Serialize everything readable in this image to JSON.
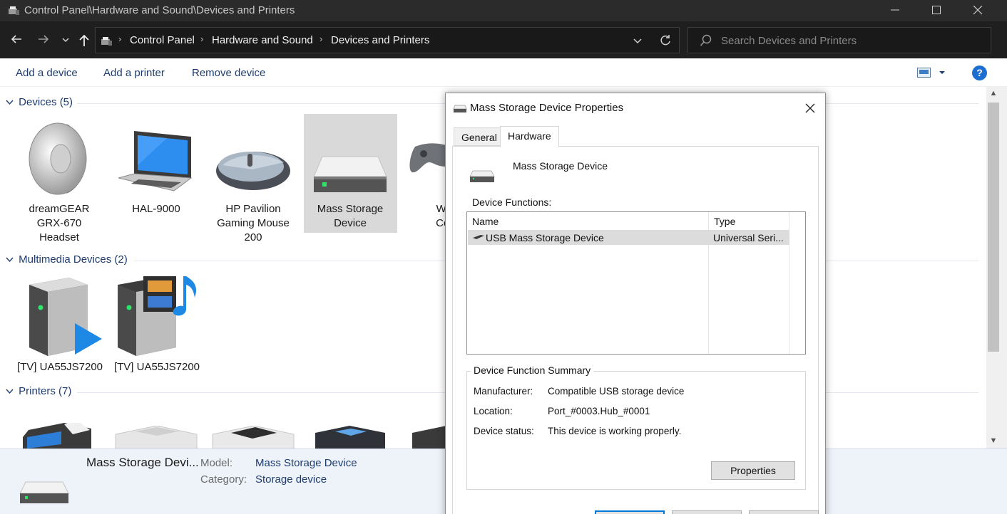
{
  "window": {
    "title": "Control Panel\\Hardware and Sound\\Devices and Printers",
    "icon": "devices-printers-icon"
  },
  "address": {
    "crumbs": [
      "Control Panel",
      "Hardware and Sound",
      "Devices and Printers"
    ],
    "search_placeholder": "Search Devices and Printers"
  },
  "commands": {
    "add_device": "Add a device",
    "add_printer": "Add a printer",
    "remove_device": "Remove device",
    "help": "?"
  },
  "groups": {
    "devices": {
      "header": "Devices (5)",
      "items": [
        {
          "label": "dreamGEAR GRX-670 Headset",
          "lines": [
            "dreamGEAR",
            "GRX-670",
            "Headset"
          ],
          "icon": "speaker-icon"
        },
        {
          "label": "HAL-9000",
          "lines": [
            "HAL-9000"
          ],
          "icon": "laptop-icon"
        },
        {
          "label": "HP Pavilion Gaming Mouse 200",
          "lines": [
            "HP Pavilion",
            "Gaming Mouse",
            "200"
          ],
          "icon": "mouse-icon"
        },
        {
          "label": "Mass Storage Device",
          "lines": [
            "Mass Storage",
            "Device"
          ],
          "icon": "drive-icon",
          "selected": true
        },
        {
          "label": "Wireless Controller",
          "lines": [
            "Wire",
            "Cont"
          ],
          "icon": "gamepad-icon"
        }
      ]
    },
    "multimedia": {
      "header": "Multimedia Devices (2)",
      "items": [
        {
          "label": "[TV] UA55JS7200",
          "lines": [
            "[TV] UA55JS7200"
          ],
          "icon": "media-renderer-icon"
        },
        {
          "label": "[TV] UA55JS7200",
          "lines": [
            "[TV] UA55JS7200"
          ],
          "icon": "media-server-icon"
        }
      ]
    },
    "printers": {
      "header": "Printers (7)"
    }
  },
  "details": {
    "name": "Mass Storage Devi...",
    "model_label": "Model:",
    "model_value": "Mass Storage Device",
    "category_label": "Category:",
    "category_value": "Storage device"
  },
  "dialog": {
    "title": "Mass Storage Device Properties",
    "tabs": [
      "General",
      "Hardware"
    ],
    "active_tab": "Hardware",
    "device_name": "Mass Storage Device",
    "functions_label": "Device Functions:",
    "columns": [
      "Name",
      "Type"
    ],
    "rows": [
      {
        "name": "USB Mass Storage Device",
        "type": "Universal Seri..."
      }
    ],
    "summary_title": "Device Function Summary",
    "summary": {
      "manufacturer_label": "Manufacturer:",
      "manufacturer_value": "Compatible USB storage device",
      "location_label": "Location:",
      "location_value": "Port_#0003.Hub_#0001",
      "status_label": "Device status:",
      "status_value": "This device is working properly."
    },
    "properties_button": "Properties"
  },
  "colors": {
    "link_blue": "#1e3c6e",
    "selection_gray": "#d9d9d9",
    "accent": "#0078d7",
    "titlebar": "#2b2b2b"
  }
}
